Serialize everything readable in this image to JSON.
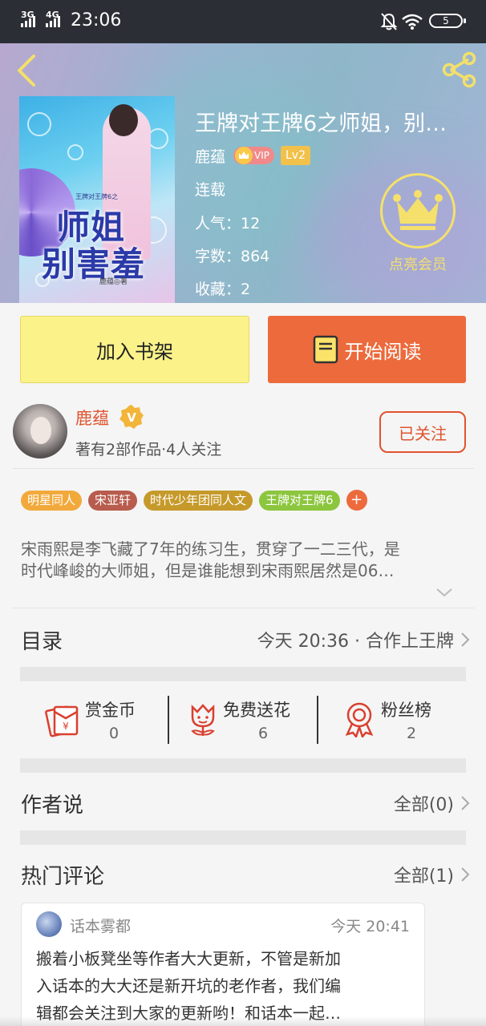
{
  "status_bar": {
    "signal_1": "3G",
    "signal_2": "4G",
    "time": "23:06",
    "battery": "5"
  },
  "book": {
    "title": "王牌对王牌6之师姐，别…",
    "author": "鹿蕴",
    "vip_label": "VIP",
    "level": "Lv2",
    "status": "连载",
    "popularity": "人气：12",
    "word_count": "字数：864",
    "favorites": "收藏：2",
    "cover": {
      "small_text": "王牌对王牌6之",
      "title_line1": "师姐",
      "title_line2": "别害羞",
      "author_mark": "鹿蕴◎著"
    }
  },
  "vip_promo": {
    "label": "点亮会员"
  },
  "actions": {
    "add_shelf": "加入书架",
    "start_read": "开始阅读"
  },
  "author_card": {
    "name": "鹿蕴",
    "verified_letter": "V",
    "sub": "著有2部作品·4人关注",
    "follow": "已关注"
  },
  "tags": [
    {
      "label": "明星同人",
      "color": "#f2a93b"
    },
    {
      "label": "宋亚轩",
      "color": "#b85c4d"
    },
    {
      "label": "时代少年团同人文",
      "color": "#c69a2a"
    },
    {
      "label": "王牌对王牌6",
      "color": "#8cc63e"
    }
  ],
  "tag_add": "+",
  "intro": {
    "line1": "宋雨熙是李飞藏了7年的练习生，贯穿了一二三代，是",
    "line2": "时代峰峻的大师姐，但是谁能想到宋雨熙居然是06…"
  },
  "catalog": {
    "label": "目录",
    "latest": "今天 20:36 · 合作上王牌"
  },
  "stats": [
    {
      "label": "赏金币",
      "value": "0"
    },
    {
      "label": "免费送花",
      "value": "6"
    },
    {
      "label": "粉丝榜",
      "value": "2"
    }
  ],
  "author_says": {
    "label": "作者说",
    "all": "全部(0)"
  },
  "hot_comments": {
    "label": "热门评论",
    "all": "全部(1)"
  },
  "comment": {
    "user": "话本雾都",
    "time": "今天 20:41",
    "line1": "搬着小板凳坐等作者大大更新，不管是新加",
    "line2": "入话本的大大还是新开坑的老作者，我们编",
    "line3": "辑都会关注到大家的更新哟！和话本一起…"
  },
  "colors": {
    "accent": "#ec6a3c",
    "author_red": "#e0532e",
    "shelf_yellow": "#fbf28a",
    "vip_gold": "#f5e06c"
  }
}
